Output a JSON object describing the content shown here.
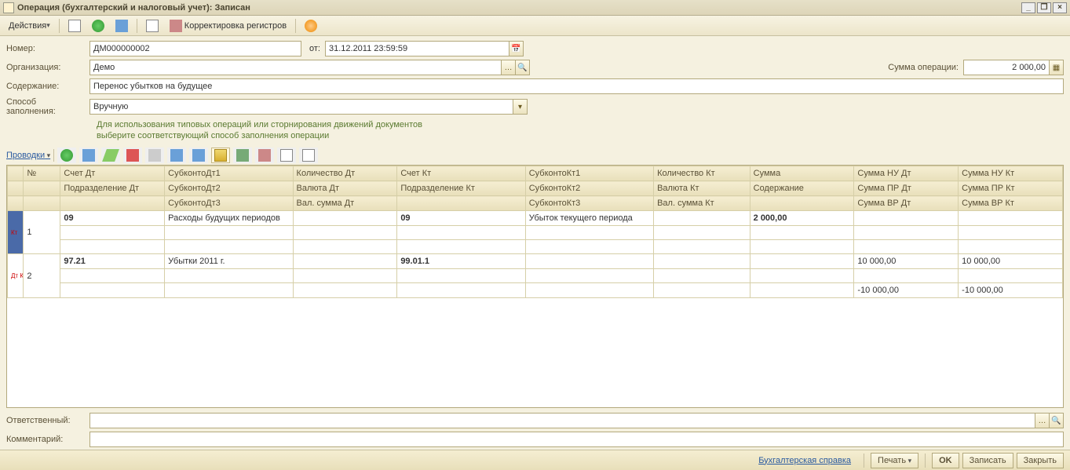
{
  "window": {
    "title": "Операция (бухгалтерский и налоговый учет): Записан"
  },
  "toolbar": {
    "actions": "Действия",
    "register_correction": "Корректировка регистров"
  },
  "form": {
    "number_label": "Номер:",
    "number_value": "ДМ000000002",
    "date_label": "от:",
    "date_value": "31.12.2011 23:59:59",
    "org_label": "Организация:",
    "org_value": "Демо",
    "sum_label": "Сумма операции:",
    "sum_value": "2 000,00",
    "content_label": "Содержание:",
    "content_value": "Перенос убытков на будущее",
    "fill_label": "Способ заполнения:",
    "fill_value": "Вручную",
    "hint1": "Для использования типовых операций или сторнирования движений документов",
    "hint2": "выберите соответствующий способ заполнения операции"
  },
  "postings": {
    "label": "Проводки"
  },
  "columns": {
    "c0": "",
    "c_num": "№",
    "c_schdt": "Счет Дт",
    "c_subdt1": "СубконтоДт1",
    "c_qtydt": "Количество Дт",
    "c_schkt": "Счет Кт",
    "c_subkt1": "СубконтоКт1",
    "c_qtykt": "Количество Кт",
    "c_sum": "Сумма",
    "c_sumnu_dt": "Сумма НУ Дт",
    "c_sumnu_kt": "Сумма НУ Кт",
    "c_podr_dt": "Подразделение Дт",
    "c_subdt2": "СубконтоДт2",
    "c_valdt": "Валюта Дт",
    "c_podr_kt": "Подразделение Кт",
    "c_subkt2": "СубконтоКт2",
    "c_valkt": "Валюта Кт",
    "c_content": "Содержание",
    "c_sumpr_dt": "Сумма ПР Дт",
    "c_sumpr_kt": "Сумма ПР Кт",
    "c_subdt3": "СубконтоДт3",
    "c_valsumdt": "Вал. сумма Дт",
    "c_subkt3": "СубконтоКт3",
    "c_valsumkt": "Вал. сумма Кт",
    "c_sumvr_dt": "Сумма ВР Дт",
    "c_sumvr_kt": "Сумма ВР Кт"
  },
  "rows": [
    {
      "indicator": "Кт",
      "num": "1",
      "schdt": "09",
      "subdt1": "Расходы будущих периодов",
      "schkt": "09",
      "subkt1": "Убыток текущего периода",
      "sum": "2 000,00",
      "sumnu_dt": "",
      "sumnu_kt": ""
    },
    {
      "indicator": "Дт Кт",
      "num": "2",
      "schdt": "97.21",
      "subdt1": "Убытки 2011 г.",
      "schkt": "99.01.1",
      "subkt1": "",
      "sum": "",
      "sumnu_dt": "10 000,00",
      "sumnu_kt": "10 000,00",
      "sumvr_dt": "-10 000,00",
      "sumvr_kt": "-10 000,00"
    }
  ],
  "bottom": {
    "resp_label": "Ответственный:",
    "resp_value": "",
    "comment_label": "Комментарий:",
    "comment_value": ""
  },
  "footer": {
    "report": "Бухгалтерская справка",
    "print": "Печать",
    "ok": "OK",
    "write": "Записать",
    "close": "Закрыть"
  }
}
